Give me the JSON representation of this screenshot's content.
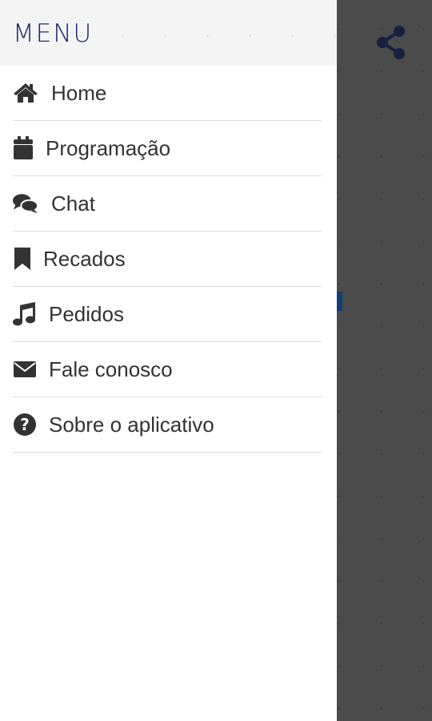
{
  "drawer": {
    "title": "MENU",
    "items": [
      {
        "label": "Home",
        "icon": "home-icon"
      },
      {
        "label": "Programação",
        "icon": "calendar-icon"
      },
      {
        "label": "Chat",
        "icon": "chat-icon"
      },
      {
        "label": "Recados",
        "icon": "bookmark-icon"
      },
      {
        "label": "Pedidos",
        "icon": "music-icon"
      },
      {
        "label": "Fale conosco",
        "icon": "envelope-icon"
      },
      {
        "label": "Sobre o aplicativo",
        "icon": "question-circle-icon"
      }
    ]
  },
  "toolbar": {
    "share_icon": "share-icon"
  },
  "colors": {
    "title": "#1f2a6e",
    "icon": "#333333",
    "text": "#333333",
    "overlay": "#4b4b4b",
    "share": "#16213f"
  }
}
